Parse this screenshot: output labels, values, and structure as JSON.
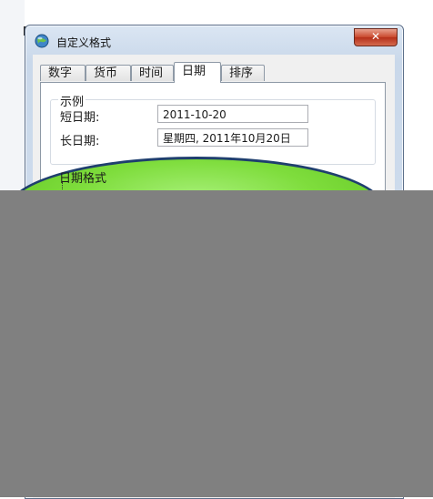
{
  "dialog": {
    "title": "自定义格式",
    "close_label": "✕"
  },
  "tabs": [
    {
      "label": "数字"
    },
    {
      "label": "货币"
    },
    {
      "label": "时间"
    },
    {
      "label": "日期",
      "active": true
    },
    {
      "label": "排序"
    }
  ],
  "sample_group": {
    "title": "示例",
    "short_date_label": "短日期:",
    "short_date_value": "2011-10-20",
    "long_date_label": "长日期:",
    "long_date_value": "星期四, 2011年10月20日"
  },
  "format_group": {
    "title": "日期格式"
  },
  "colors": {
    "highlight_fill": "#7fdd3d",
    "highlight_border": "#1f3f6e",
    "overlay": "#808080"
  }
}
